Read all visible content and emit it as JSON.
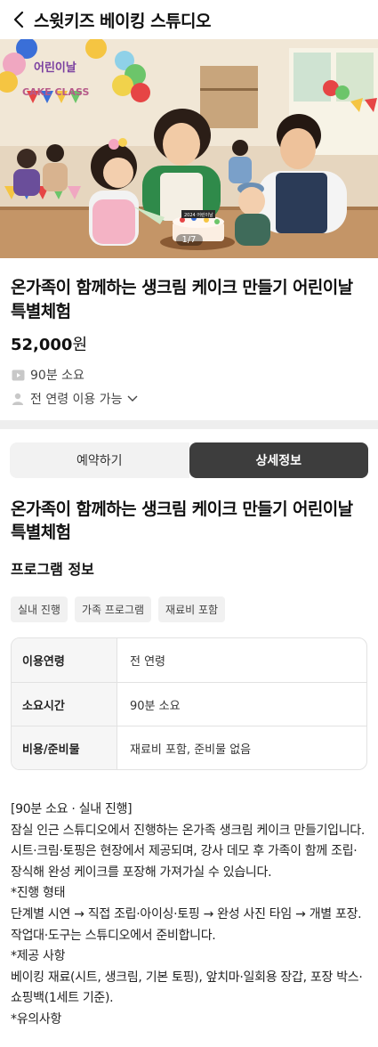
{
  "header": {
    "title": "스윗키즈 베이킹 스튜디오"
  },
  "hero": {
    "counter": "1/7",
    "banner_text": "어린이날",
    "cake_class_text": "CAKE CLASS",
    "cake_topper_text": "2024 어린이날",
    "apron_text": "Cake Studio"
  },
  "product": {
    "title": "온가족이 함께하는 생크림 케이크 만들기 어린이날 특별체험",
    "price": "52,000",
    "price_unit": "원",
    "duration": "90분 소요",
    "age": "전 연령 이용 가능"
  },
  "tabs": [
    {
      "label": "예약하기",
      "active": false
    },
    {
      "label": "상세정보",
      "active": true
    }
  ],
  "detail": {
    "title": "온가족이 함께하는 생크림 케이크 만들기 어린이날 특별체험",
    "section_title": "프로그램 정보",
    "chips": [
      "실내 진행",
      "가족 프로그램",
      "재료비 포함"
    ],
    "table": [
      {
        "key": "이용연령",
        "value": "전 연령"
      },
      {
        "key": "소요시간",
        "value": "90분 소요"
      },
      {
        "key": "비용/준비물",
        "value": "재료비 포함, 준비물 없음"
      }
    ],
    "description": [
      "[90분 소요 · 실내 진행]",
      "잠실 인근 스튜디오에서 진행하는 온가족 생크림 케이크 만들기입니다. 시트·크림·토핑은 현장에서 제공되며, 강사 데모 후 가족이 함께 조립·장식해 완성 케이크를 포장해 가져가실 수 있습니다.",
      "*진행 형태",
      "단계별 시연 → 직접 조립·아이싱·토핑 → 완성 사진 타임 → 개별 포장. 작업대·도구는 스튜디오에서 준비합니다.",
      "*제공 사항",
      "베이킹 재료(시트, 생크림, 기본 토핑), 앞치마·일회용 장갑, 포장 박스·쇼핑백(1세트 기준).",
      "*유의사항"
    ]
  },
  "colors": {
    "active_tab": "#3d3d3d",
    "divider": "#eeeeee"
  }
}
